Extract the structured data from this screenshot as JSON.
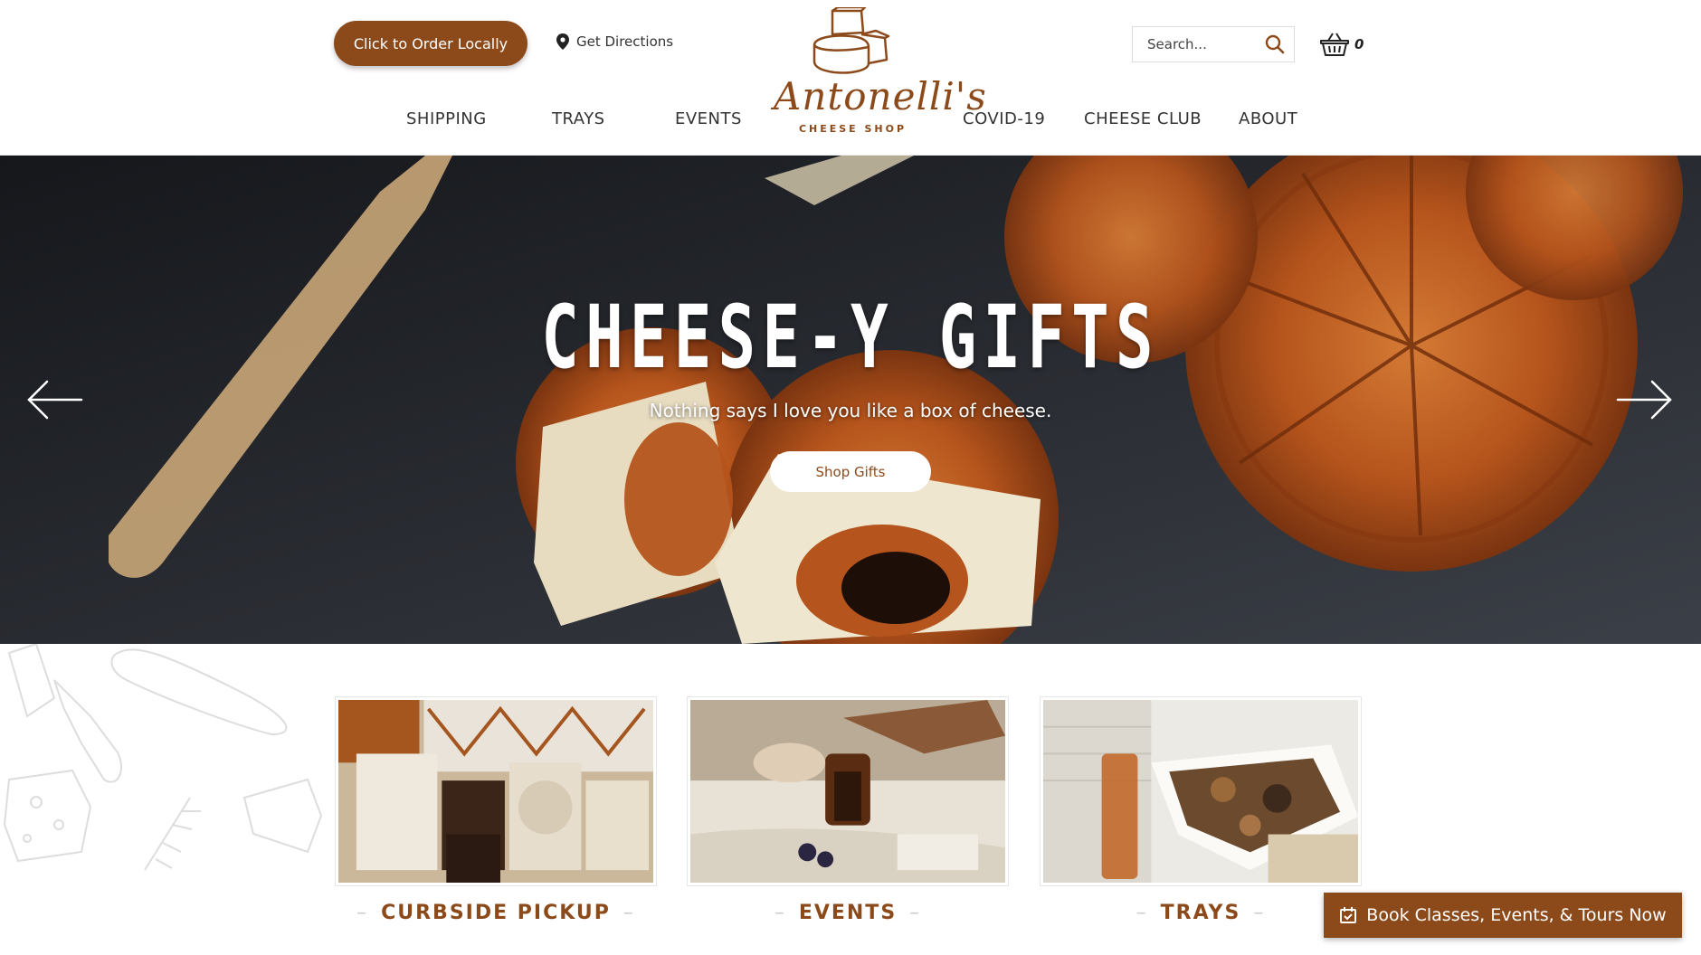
{
  "header": {
    "order_button": "Click to Order Locally",
    "directions_label": "Get Directions",
    "logo": {
      "name": "Antonelli's",
      "subtitle": "CHEESE SHOP"
    },
    "search_placeholder": "Search...",
    "cart_count": "0",
    "nav": {
      "shipping": "SHIPPING",
      "trays": "TRAYS",
      "events": "EVENTS",
      "covid": "COVID-19",
      "cheese_club": "CHEESE CLUB",
      "about": "ABOUT"
    }
  },
  "hero": {
    "title": "CHEESE-Y GIFTS",
    "subtitle": "Nothing says I love you like a box of cheese.",
    "button": "Shop Gifts"
  },
  "cards": [
    {
      "label": "CURBSIDE PICKUP"
    },
    {
      "label": "EVENTS"
    },
    {
      "label": "TRAYS"
    }
  ],
  "book_button": "Book Classes, Events, & Tours Now",
  "colors": {
    "brand": "#8c4a1b",
    "hero_dark": "#1c1e22",
    "orange": "#b5541c"
  },
  "icons": [
    "map-pin-icon",
    "search-icon",
    "basket-icon",
    "arrow-left-icon",
    "arrow-right-icon",
    "calendar-check-icon"
  ]
}
